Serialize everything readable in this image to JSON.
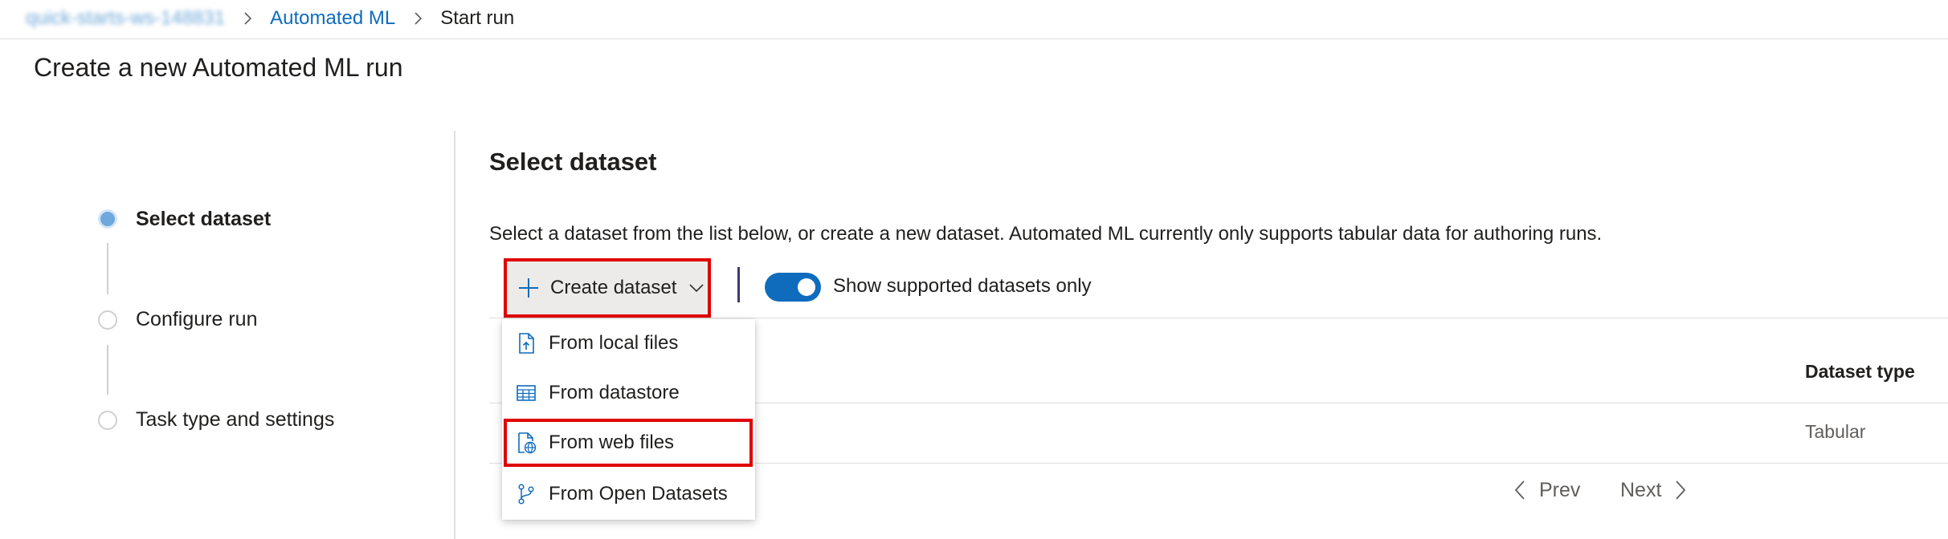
{
  "breadcrumb": {
    "workspace": "quick-starts-ws-148831",
    "service": "Automated ML",
    "current": "Start run"
  },
  "page": {
    "title": "Create a new Automated ML run"
  },
  "steps": [
    {
      "label": "Select dataset",
      "state": "active"
    },
    {
      "label": "Configure run",
      "state": "idle"
    },
    {
      "label": "Task type and settings",
      "state": "idle"
    }
  ],
  "section": {
    "title": "Select dataset",
    "description": "Select a dataset from the list below, or create a new dataset. Automated ML currently only supports tabular data for authoring runs."
  },
  "toolbar": {
    "create_label": "Create dataset",
    "toggle_label": "Show supported datasets only",
    "toggle_on": true
  },
  "menu": {
    "items": [
      {
        "label": "From local files",
        "icon": "file-upload-icon"
      },
      {
        "label": "From datastore",
        "icon": "table-grid-icon"
      },
      {
        "label": "From web files",
        "icon": "web-file-icon",
        "highlighted": true
      },
      {
        "label": "From Open Datasets",
        "icon": "branch-icon"
      }
    ]
  },
  "table": {
    "column_dataset_type": "Dataset type",
    "row_dataset_type": "Tabular"
  },
  "pager": {
    "prev": "Prev",
    "next": "Next"
  },
  "colors": {
    "accent": "#0f6cbd",
    "highlight_border": "#e00000",
    "active_step": "#6fa8dc"
  }
}
